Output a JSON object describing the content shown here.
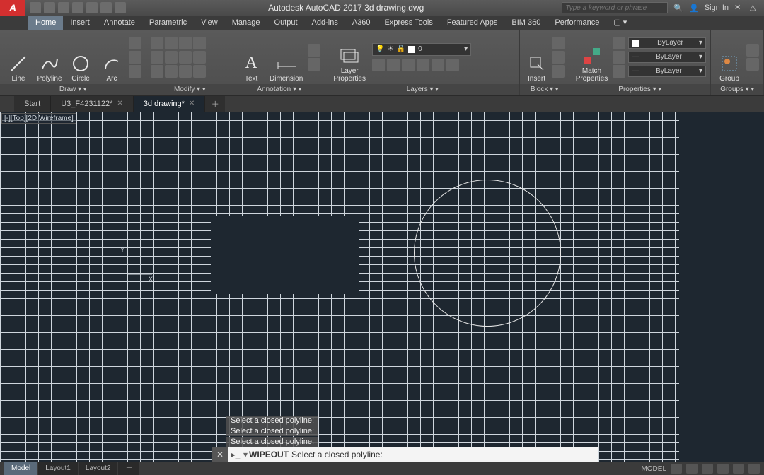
{
  "app": {
    "title": "Autodesk AutoCAD 2017   3d drawing.dwg",
    "search_placeholder": "Type a keyword or phrase",
    "signin": "Sign In"
  },
  "ribbon_tabs": [
    "Home",
    "Insert",
    "Annotate",
    "Parametric",
    "View",
    "Manage",
    "Output",
    "Add-ins",
    "A360",
    "Express Tools",
    "Featured Apps",
    "BIM 360",
    "Performance"
  ],
  "ribbon_active": "Home",
  "panels": {
    "draw": {
      "title": "Draw ▾",
      "tools": [
        "Line",
        "Polyline",
        "Circle",
        "Arc"
      ]
    },
    "modify": {
      "title": "Modify ▾"
    },
    "annotation": {
      "title": "Annotation ▾",
      "tools": [
        "Text",
        "Dimension"
      ]
    },
    "layers": {
      "title": "Layers ▾",
      "big": "Layer Properties",
      "current": "0"
    },
    "block": {
      "title": "Block ▾",
      "big": "Insert"
    },
    "properties": {
      "title": "Properties ▾",
      "big": "Match Properties",
      "rows": [
        "ByLayer",
        "ByLayer",
        "ByLayer"
      ]
    },
    "groups": {
      "title": "Groups ▾",
      "big": "Group"
    }
  },
  "file_tabs": [
    {
      "label": "Start",
      "active": false,
      "closable": false
    },
    {
      "label": "U3_F4231122*",
      "active": false,
      "closable": true
    },
    {
      "label": "3d drawing*",
      "active": true,
      "closable": true
    }
  ],
  "viewport_controls": "[-][Top][2D Wireframe]",
  "command_history": [
    "Select a closed polyline:",
    "Select a closed polyline:",
    "Select a closed polyline:"
  ],
  "command_line": {
    "cmd": "WIPEOUT",
    "prompt": "Select a closed polyline:"
  },
  "layout_tabs": [
    "Model",
    "Layout1",
    "Layout2"
  ],
  "layout_active": "Model",
  "status_right_label": "MODEL"
}
